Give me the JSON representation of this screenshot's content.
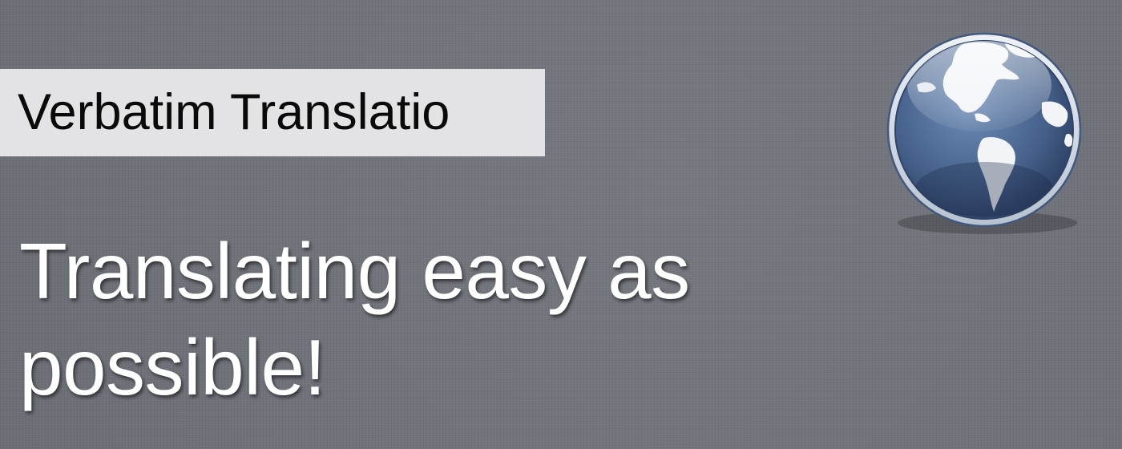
{
  "header": {
    "app_name": "Verbatim Translatio"
  },
  "hero": {
    "tagline": "Translating easy as possible!"
  },
  "logo": {
    "icon": "globe-icon"
  },
  "colors": {
    "background": "#70727a",
    "label_background": "#e3e3e5",
    "globe_blue": "#4a6a96"
  }
}
